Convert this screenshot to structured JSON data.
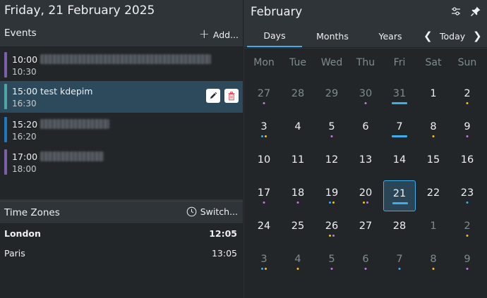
{
  "header": {
    "date_title": "Friday, 21 February 2025"
  },
  "events": {
    "label": "Events",
    "add_label": "Add...",
    "items": [
      {
        "start": "10:00",
        "end": "10:30",
        "title": "",
        "color": "#7b5fa8",
        "blurred": true,
        "highlighted": false
      },
      {
        "start": "15:00",
        "end": "16:30",
        "title": "test kdepim",
        "color": "#4fa6a6",
        "blurred": false,
        "highlighted": true
      },
      {
        "start": "15:20",
        "end": "16:20",
        "title": "",
        "color": "#1d77c1",
        "blurred": true,
        "highlighted": false
      },
      {
        "start": "17:00",
        "end": "18:00",
        "title": "",
        "color": "#7b5fa8",
        "blurred": true,
        "highlighted": false
      }
    ]
  },
  "time_zones": {
    "label": "Time Zones",
    "switch_label": "Switch...",
    "rows": [
      {
        "city": "London",
        "time": "12:05",
        "bold": true
      },
      {
        "city": "Paris",
        "time": "13:05",
        "bold": false
      }
    ]
  },
  "calendar": {
    "month_title": "February",
    "tabs": [
      {
        "label": "Days",
        "active": true
      },
      {
        "label": "Months",
        "active": false
      },
      {
        "label": "Years",
        "active": false
      }
    ],
    "today_label": "Today",
    "weekdays": [
      "Mon",
      "Tue",
      "Wed",
      "Thu",
      "Fri",
      "Sat",
      "Sun"
    ],
    "weeks": [
      [
        "27",
        "28",
        "29",
        "30",
        "31",
        "1",
        "2"
      ],
      [
        "3",
        "4",
        "5",
        "6",
        "7",
        "8",
        "9"
      ],
      [
        "10",
        "11",
        "12",
        "13",
        "14",
        "15",
        "16"
      ],
      [
        "17",
        "18",
        "19",
        "20",
        "21",
        "22",
        "23"
      ],
      [
        "24",
        "25",
        "26",
        "27",
        "28",
        "1",
        "2"
      ],
      [
        "3",
        "4",
        "5",
        "6",
        "7",
        "8",
        "9"
      ]
    ],
    "today": "21",
    "accent_color": "#3daee9"
  }
}
